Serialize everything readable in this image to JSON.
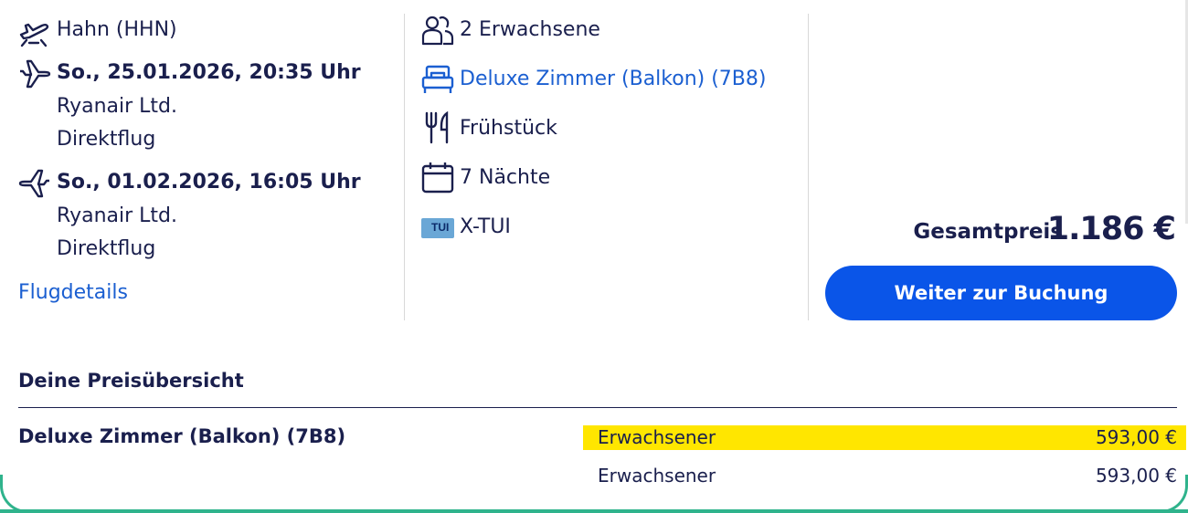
{
  "flight": {
    "departure_airport": "Hahn (HHN)",
    "outbound_datetime": "So., 25.01.2026, 20:35 Uhr",
    "outbound_airline": "Ryanair Ltd.",
    "outbound_type": "Direktflug",
    "return_datetime": "So., 01.02.2026, 16:05 Uhr",
    "return_airline": "Ryanair Ltd.",
    "return_type": "Direktflug",
    "details_link": "Flugdetails"
  },
  "hotel": {
    "travelers": "2 Erwachsene",
    "room": "Deluxe Zimmer (Balkon) (7B8)",
    "board": "Frühstück",
    "nights": "7 Nächte",
    "brand": "X-TUI",
    "brand_logo_text": "TUI"
  },
  "price": {
    "total_label": "Gesamtpreis",
    "total_value": "1.186 €",
    "book_button": "Weiter zur Buchung"
  },
  "overview": {
    "title": "Deine Preisübersicht",
    "room_label": "Deluxe Zimmer (Balkon) (7B8)",
    "lines": [
      {
        "label": "Erwachsener",
        "value": "593,00 €"
      },
      {
        "label": "Erwachsener",
        "value": "593,00 €"
      }
    ]
  },
  "colors": {
    "text": "#1a1f4d",
    "link": "#1b5fd1",
    "button": "#0a55e8",
    "highlight": "#ffe600",
    "accent_border": "#2fb38c"
  }
}
